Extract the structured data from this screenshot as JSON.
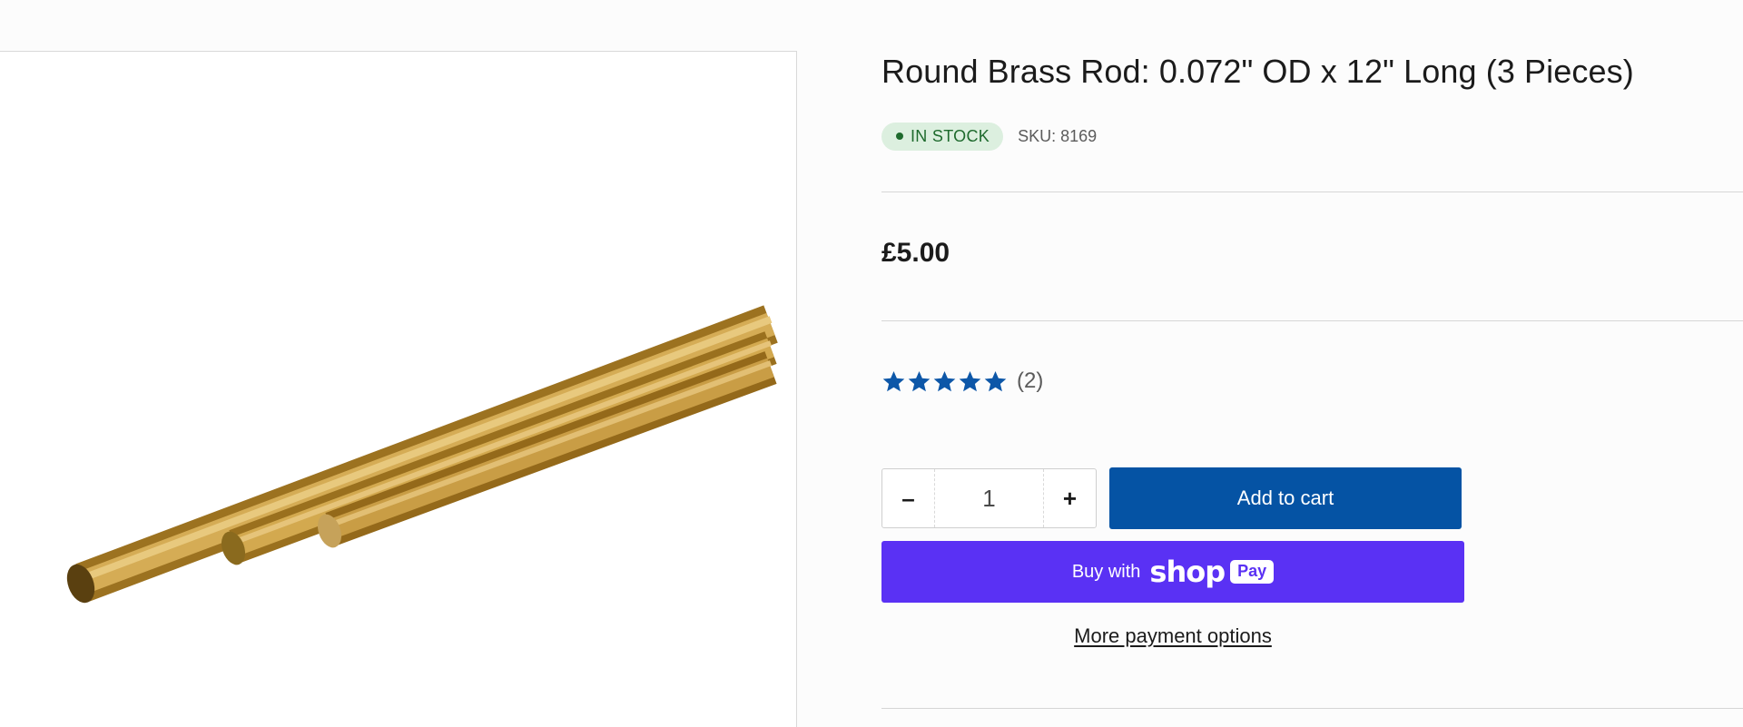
{
  "product": {
    "title": "Round Brass Rod: 0.072\" OD x 12\" Long (3 Pieces)",
    "stock_status": "IN STOCK",
    "sku": "SKU: 8169",
    "price": "£5.00",
    "rating": {
      "stars": 5,
      "max": 5,
      "count_label": "(2)"
    }
  },
  "purchase": {
    "minus_label": "–",
    "quantity": "1",
    "plus_label": "+",
    "add_to_cart_label": "Add to cart",
    "shop_pay_prefix": "Buy with",
    "shop_pay_brand": "shop",
    "shop_pay_pill": "Pay",
    "more_payment_options": "More payment options"
  },
  "colors": {
    "accent_blue": "#0553a4",
    "star_blue": "#0d57a8",
    "shop_pay_purple": "#5a31f4",
    "in_stock_bg": "#dcefdf",
    "in_stock_text": "#1e6a2d"
  },
  "icons": {
    "star": "star-icon",
    "stock_dot": "status-dot-icon"
  }
}
